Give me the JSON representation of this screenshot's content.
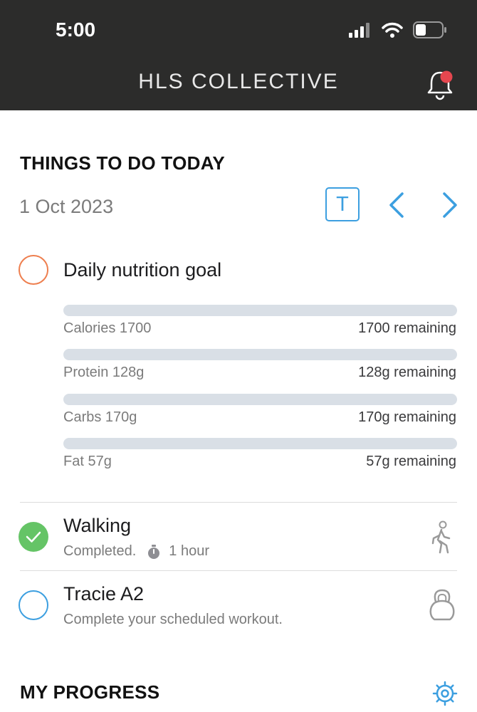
{
  "status_bar": {
    "time": "5:00"
  },
  "header": {
    "brand": "HLS COLLECTIVE"
  },
  "todo": {
    "title": "THINGS TO DO TODAY",
    "date": "1 Oct 2023",
    "today_label": "T"
  },
  "nutrition": {
    "title": "Daily nutrition goal",
    "items": [
      {
        "label": "Calories 1700",
        "remaining": "1700 remaining",
        "progress": 0
      },
      {
        "label": "Protein 128g",
        "remaining": "128g remaining",
        "progress": 0
      },
      {
        "label": "Carbs 170g",
        "remaining": "170g remaining",
        "progress": 0
      },
      {
        "label": "Fat 57g",
        "remaining": "57g remaining",
        "progress": 0
      }
    ]
  },
  "walking": {
    "title": "Walking",
    "status": "Completed.",
    "duration": "1 hour"
  },
  "workout": {
    "title": "Tracie A2",
    "subtitle": "Complete your scheduled workout."
  },
  "progress": {
    "title": "MY PROGRESS"
  },
  "colors": {
    "accent": "#3c9fe0",
    "header_bg": "#2c2c2b",
    "nutrition_ring": "#ee7f4f",
    "completed": "#65c466",
    "notification": "#e5474f"
  },
  "icons": [
    "signal-icon",
    "wifi-icon",
    "battery-icon",
    "bell-icon",
    "chevron-left-icon",
    "chevron-right-icon",
    "walking-icon",
    "kettlebell-icon",
    "stopwatch-icon",
    "check-icon",
    "gear-icon"
  ]
}
